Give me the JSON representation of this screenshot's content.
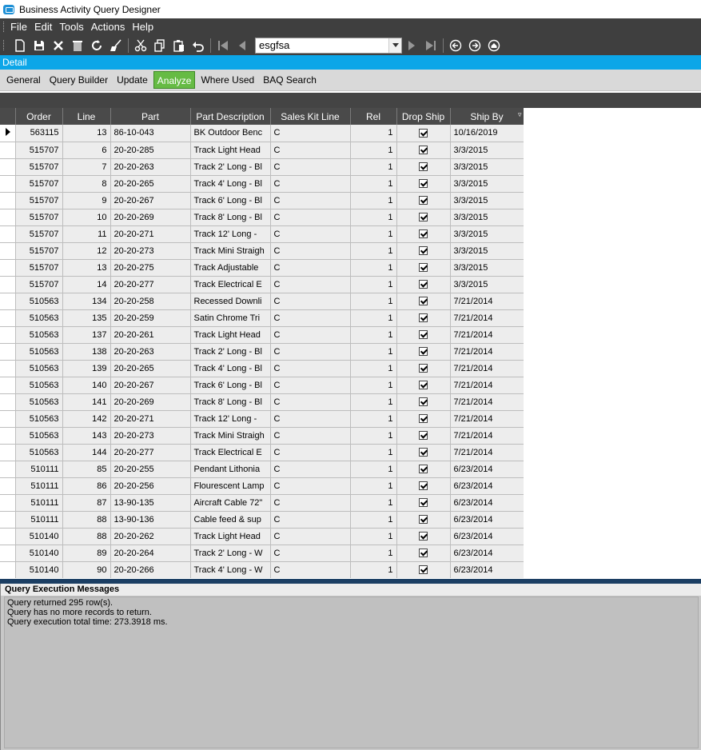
{
  "window": {
    "title": "Business Activity Query Designer"
  },
  "menu": {
    "items": [
      "File",
      "Edit",
      "Tools",
      "Actions",
      "Help"
    ]
  },
  "toolbar": {
    "combo_value": "esgfsa"
  },
  "detail": {
    "label": "Detail"
  },
  "tabs": [
    {
      "label": "General",
      "active": false
    },
    {
      "label": "Query Builder",
      "active": false
    },
    {
      "label": "Update",
      "active": false
    },
    {
      "label": "Analyze",
      "active": true
    },
    {
      "label": "Where Used",
      "active": false
    },
    {
      "label": "BAQ Search",
      "active": false
    }
  ],
  "grid": {
    "columns": [
      "Order",
      "Line",
      "Part",
      "Part Description",
      "Sales Kit Line",
      "Rel",
      "Drop Ship",
      "Ship By"
    ],
    "rows": [
      [
        "563115",
        "13",
        "86-10-043",
        "BK Outdoor Benc",
        "C",
        "1",
        true,
        "10/16/2019"
      ],
      [
        "515707",
        "6",
        "20-20-285",
        "Track Light Head",
        "C",
        "1",
        true,
        "3/3/2015"
      ],
      [
        "515707",
        "7",
        "20-20-263",
        "Track 2' Long - Bl",
        "C",
        "1",
        true,
        "3/3/2015"
      ],
      [
        "515707",
        "8",
        "20-20-265",
        "Track 4' Long - Bl",
        "C",
        "1",
        true,
        "3/3/2015"
      ],
      [
        "515707",
        "9",
        "20-20-267",
        "Track 6' Long - Bl",
        "C",
        "1",
        true,
        "3/3/2015"
      ],
      [
        "515707",
        "10",
        "20-20-269",
        "Track 8' Long - Bl",
        "C",
        "1",
        true,
        "3/3/2015"
      ],
      [
        "515707",
        "11",
        "20-20-271",
        "Track 12' Long -",
        "C",
        "1",
        true,
        "3/3/2015"
      ],
      [
        "515707",
        "12",
        "20-20-273",
        "Track Mini Straigh",
        "C",
        "1",
        true,
        "3/3/2015"
      ],
      [
        "515707",
        "13",
        "20-20-275",
        "Track Adjustable",
        "C",
        "1",
        true,
        "3/3/2015"
      ],
      [
        "515707",
        "14",
        "20-20-277",
        "Track Electrical E",
        "C",
        "1",
        true,
        "3/3/2015"
      ],
      [
        "510563",
        "134",
        "20-20-258",
        "Recessed Downli",
        "C",
        "1",
        true,
        "7/21/2014"
      ],
      [
        "510563",
        "135",
        "20-20-259",
        "Satin Chrome Tri",
        "C",
        "1",
        true,
        "7/21/2014"
      ],
      [
        "510563",
        "137",
        "20-20-261",
        "Track Light Head",
        "C",
        "1",
        true,
        "7/21/2014"
      ],
      [
        "510563",
        "138",
        "20-20-263",
        "Track 2' Long - Bl",
        "C",
        "1",
        true,
        "7/21/2014"
      ],
      [
        "510563",
        "139",
        "20-20-265",
        "Track 4' Long - Bl",
        "C",
        "1",
        true,
        "7/21/2014"
      ],
      [
        "510563",
        "140",
        "20-20-267",
        "Track 6' Long - Bl",
        "C",
        "1",
        true,
        "7/21/2014"
      ],
      [
        "510563",
        "141",
        "20-20-269",
        "Track 8' Long - Bl",
        "C",
        "1",
        true,
        "7/21/2014"
      ],
      [
        "510563",
        "142",
        "20-20-271",
        "Track 12' Long -",
        "C",
        "1",
        true,
        "7/21/2014"
      ],
      [
        "510563",
        "143",
        "20-20-273",
        "Track Mini Straigh",
        "C",
        "1",
        true,
        "7/21/2014"
      ],
      [
        "510563",
        "144",
        "20-20-277",
        "Track Electrical E",
        "C",
        "1",
        true,
        "7/21/2014"
      ],
      [
        "510111",
        "85",
        "20-20-255",
        "Pendant Lithonia",
        "C",
        "1",
        true,
        "6/23/2014"
      ],
      [
        "510111",
        "86",
        "20-20-256",
        "Flourescent Lamp",
        "C",
        "1",
        true,
        "6/23/2014"
      ],
      [
        "510111",
        "87",
        "13-90-135",
        "Aircraft Cable 72\"",
        "C",
        "1",
        true,
        "6/23/2014"
      ],
      [
        "510111",
        "88",
        "13-90-136",
        "Cable feed & sup",
        "C",
        "1",
        true,
        "6/23/2014"
      ],
      [
        "510140",
        "88",
        "20-20-262",
        "Track Light Head",
        "C",
        "1",
        true,
        "6/23/2014"
      ],
      [
        "510140",
        "89",
        "20-20-264",
        "Track 2' Long - W",
        "C",
        "1",
        true,
        "6/23/2014"
      ],
      [
        "510140",
        "90",
        "20-20-266",
        "Track 4' Long - W",
        "C",
        "1",
        true,
        "6/23/2014"
      ]
    ]
  },
  "messages": {
    "title": "Query Execution Messages",
    "lines": [
      "Query returned 295 row(s).",
      "Query has no more records to return.",
      "Query execution total time: 273.3918 ms."
    ]
  },
  "colors": {
    "accent": "#0ca6e8",
    "active_tab": "#66bb44",
    "chrome": "#3f3f3f"
  }
}
